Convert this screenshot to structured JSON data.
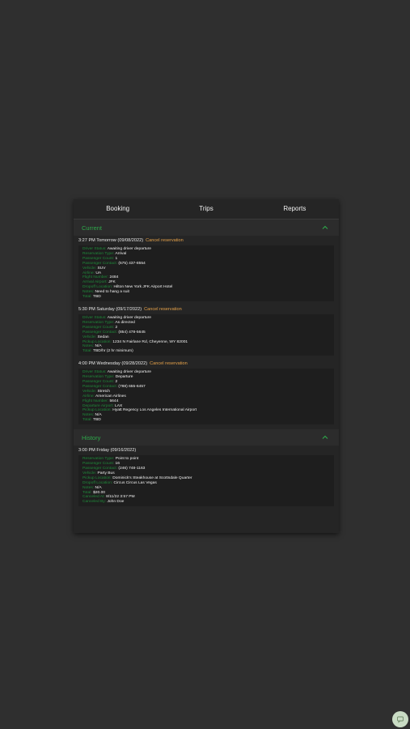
{
  "nav": {
    "tabs": [
      "Booking",
      "Trips",
      "Reports"
    ]
  },
  "current": {
    "title": "Current"
  },
  "history": {
    "title": "History"
  },
  "cancel_label": "Cancel reservation",
  "trips": [
    {
      "heading": "3:27 PM Tomorrow (09/08/2022)",
      "rows": [
        {
          "label": "Driver Status:",
          "value": "Awaiting driver departure"
        },
        {
          "label": "Reservation Type:",
          "value": "Arrival"
        },
        {
          "label": "Passenger Count:",
          "value": "1"
        },
        {
          "label": "Passenger Contact:",
          "value": "(575) 437-8554"
        },
        {
          "label": "Vehicle:",
          "value": "SUV"
        },
        {
          "label": "Airline:",
          "value": "UA"
        },
        {
          "label": "Flight Number:",
          "value": "2484"
        },
        {
          "label": "Arrival Airport:",
          "value": "JFK"
        },
        {
          "label": "Dropoff Location:",
          "value": "Hilton New York JFK Airport Hotel"
        },
        {
          "label": "Notes:",
          "value": "Need to hang a suit"
        },
        {
          "label": "Total:",
          "value": "TBD"
        }
      ]
    },
    {
      "heading": "5:30 PM Saturday (09/17/2022)",
      "rows": [
        {
          "label": "Driver Status:",
          "value": "Awaiting driver departure"
        },
        {
          "label": "Reservation Type:",
          "value": "As directed"
        },
        {
          "label": "Passenger Count:",
          "value": "2"
        },
        {
          "label": "Passenger Contact:",
          "value": "(854) 478-5645"
        },
        {
          "label": "Vehicle:",
          "value": "Sedan"
        },
        {
          "label": "Pickup Location:",
          "value": "1234 N Fairlane Rd, Cheyenne, WY 82001"
        },
        {
          "label": "Notes:",
          "value": "N/A"
        },
        {
          "label": "Total:",
          "value": "TBD/hr (2 hr minimum)"
        }
      ]
    },
    {
      "heading": "4:00 PM Wednesday (09/28/2022)",
      "rows": [
        {
          "label": "Driver Status:",
          "value": "Awaiting driver departure"
        },
        {
          "label": "Reservation Type:",
          "value": "Departure"
        },
        {
          "label": "Passenger Count:",
          "value": "2"
        },
        {
          "label": "Passenger Contact:",
          "value": "(788) 655-6457"
        },
        {
          "label": "Vehicle:",
          "value": "Stretch"
        },
        {
          "label": "Airline:",
          "value": "American Airlines"
        },
        {
          "label": "Flight Number:",
          "value": "5644"
        },
        {
          "label": "Departure Airport:",
          "value": "LAX"
        },
        {
          "label": "Pickup Location:",
          "value": "Hyatt Regency Los Angeles International Airport"
        },
        {
          "label": "Notes:",
          "value": "N/A"
        },
        {
          "label": "Total:",
          "value": "TBD"
        }
      ]
    }
  ],
  "past_trips": [
    {
      "heading": "3:00 PM Friday (09/16/2022)",
      "rows": [
        {
          "label": "Reservation Type:",
          "value": "Point to point"
        },
        {
          "label": "Passenger Count:",
          "value": "16"
        },
        {
          "label": "Passenger Contact:",
          "value": "(246) 748-1163"
        },
        {
          "label": "Vehicle:",
          "value": "Party Bus"
        },
        {
          "label": "Pickup Location:",
          "value": "Dominick's Steakhouse at Scottsdale Quarter"
        },
        {
          "label": "Dropoff Location:",
          "value": "Circus Circus Las Vegas"
        },
        {
          "label": "Notes:",
          "value": "N/A"
        },
        {
          "label": "Total:",
          "value": "$20.00"
        },
        {
          "label": "Canceled At:",
          "value": "8/11/22 3:57 PM"
        },
        {
          "label": "Canceled By:",
          "value": "John Doe"
        }
      ]
    }
  ],
  "colors": {
    "accent_green": "#2ea84a",
    "label_green": "#1f8a3a",
    "cancel_orange": "#e6a24a"
  },
  "icons": {
    "collapse": "chevron-up-icon",
    "fab": "chat-icon"
  }
}
